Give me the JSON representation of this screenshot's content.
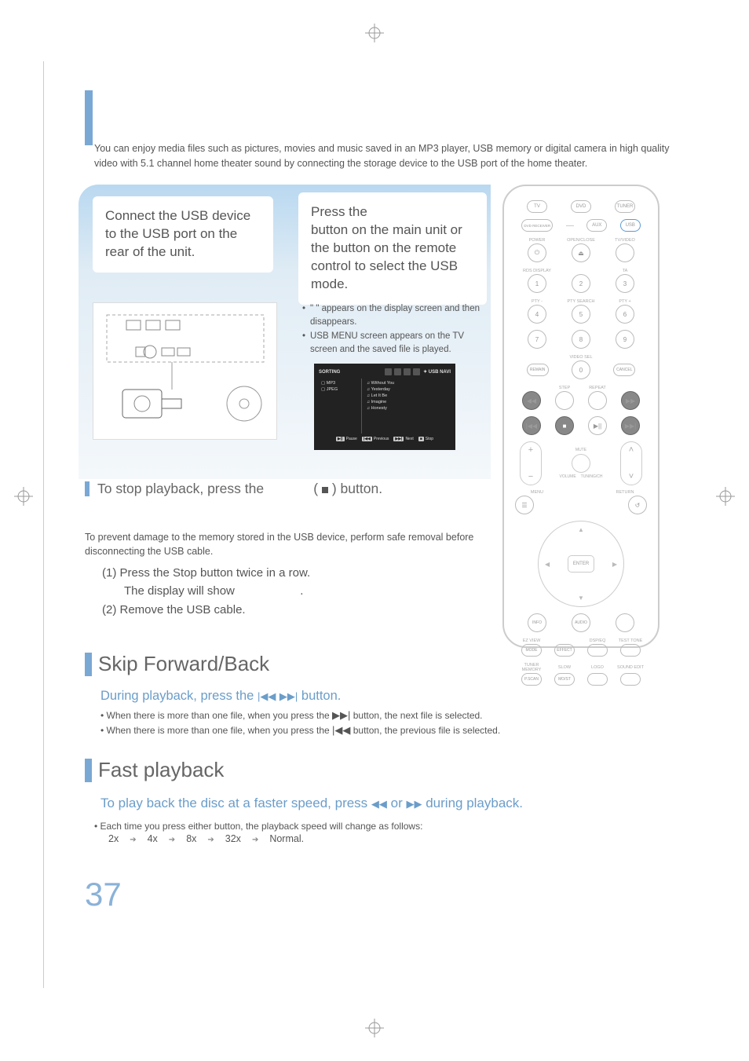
{
  "intro": "You can enjoy media files such as pictures, movies and music saved in an MP3 player, USB memory or digital camera in high quality video with 5.1 channel home theater sound by connecting the storage device to the USB port of the home theater.",
  "step1": "Connect the USB device to the USB port on the rear of the unit.",
  "step2_prefix": "Press the ",
  "step2_line2a": "button on the main unit or the ",
  "step2_line2b": "button on the remote control to select the USB mode.",
  "usb_appears_a": "\" ",
  "usb_appears_b": "\" appears on the display screen and then disappears.",
  "usb_menu_appears": "USB MENU screen appears on the TV screen and the saved file is played.",
  "usb_nav": {
    "sorting": "SORTING",
    "right_label": "USB NAVI",
    "left_items": [
      "MP3",
      "JPEG"
    ],
    "right_items": [
      "Without You",
      "Yesterday",
      "Let It Be",
      "Imagine",
      "Honesty"
    ],
    "footer": [
      "Pause",
      "Previous",
      "Next",
      "Stop"
    ]
  },
  "stop_line_a": "To stop playback, press the ",
  "stop_line_b": "(",
  "stop_line_c": ") button.",
  "safe_removal": "To prevent damage to the memory stored in the USB device, perform safe removal before disconnecting the USB cable.",
  "steps": {
    "one_a": "(1)  Press the Stop button twice in a row.",
    "one_b": "The display will show ",
    "one_c": ".",
    "two": "(2) Remove the USB cable."
  },
  "skip": {
    "title": "Skip Forward/Back",
    "instruction_a": "During playback, press the",
    "instruction_b": "button.",
    "bullet1_a": "• When there is more than one file, when you press the ",
    "bullet1_b": " button, the next file is selected.",
    "bullet2_a": "• When there is more than one file, when you press the ",
    "bullet2_b": " button, the previous file is selected."
  },
  "fast": {
    "title": "Fast playback",
    "instruction_a": "To play back the disc at a faster speed, press ",
    "instruction_b": " or ",
    "instruction_c": " during playback.",
    "bullet": "• Each time you press either button, the playback speed will change as follows:",
    "speeds": [
      "2x",
      "4x",
      "8x",
      "32x",
      "Normal."
    ]
  },
  "page_number": "37",
  "remote": {
    "top_row": [
      "TV",
      "DVD",
      "TUNER"
    ],
    "row2": [
      "DVD RECEIVER",
      "AUX",
      "USB"
    ],
    "labels_r3": [
      "POWER",
      "OPEN/CLOSE",
      "TV/VIDEO"
    ],
    "labels_r4": [
      "RDS DISPLAY",
      "",
      "TA"
    ],
    "numbers": [
      "1",
      "2",
      "3",
      "4",
      "5",
      "6",
      "7",
      "8",
      "9",
      "0"
    ],
    "label_pty": [
      "PTY -",
      "PTY SEARCH",
      "PTY +"
    ],
    "label_video": "VIDEO SEL",
    "remain": "REMAIN",
    "cancel": "CANCEL",
    "step": "STEP",
    "repeat": "REPEAT",
    "mute": "MUTE",
    "volume": "VOLUME",
    "tuning": "TUNING/CH",
    "menu": "MENU",
    "return": "RETURN",
    "enter": "ENTER",
    "info": "INFO",
    "audio": "AUDIO",
    "bottom_r1": [
      "EZ VIEW",
      "",
      "DSP/EQ",
      "TEST TONE"
    ],
    "bottom_r2": [
      "MODE",
      "EFFECT",
      "",
      ""
    ],
    "bottom_r3": [
      "TUNER MEMORY",
      "SLOW",
      "LOGO",
      "SOUND EDIT"
    ],
    "bottom_r4": [
      "P.SCAN",
      "MO/ST",
      "",
      ""
    ]
  }
}
